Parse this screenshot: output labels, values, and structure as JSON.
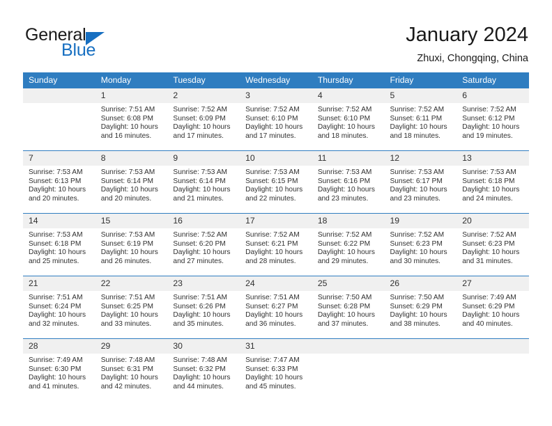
{
  "brand": {
    "name_part1": "General",
    "name_part2": "Blue",
    "triangle_color": "#176fc1"
  },
  "header": {
    "month_title": "January 2024",
    "location": "Zhuxi, Chongqing, China"
  },
  "colors": {
    "header_blue": "#2f7dc0",
    "brand_blue": "#176fc1",
    "daynum_band": "#f0f0f0",
    "text": "#303030"
  },
  "weekday_headers": [
    "Sunday",
    "Monday",
    "Tuesday",
    "Wednesday",
    "Thursday",
    "Friday",
    "Saturday"
  ],
  "weeks": [
    [
      {
        "day": "",
        "lines": []
      },
      {
        "day": "1",
        "lines": [
          "Sunrise: 7:51 AM",
          "Sunset: 6:08 PM",
          "Daylight: 10 hours",
          "and 16 minutes."
        ]
      },
      {
        "day": "2",
        "lines": [
          "Sunrise: 7:52 AM",
          "Sunset: 6:09 PM",
          "Daylight: 10 hours",
          "and 17 minutes."
        ]
      },
      {
        "day": "3",
        "lines": [
          "Sunrise: 7:52 AM",
          "Sunset: 6:10 PM",
          "Daylight: 10 hours",
          "and 17 minutes."
        ]
      },
      {
        "day": "4",
        "lines": [
          "Sunrise: 7:52 AM",
          "Sunset: 6:10 PM",
          "Daylight: 10 hours",
          "and 18 minutes."
        ]
      },
      {
        "day": "5",
        "lines": [
          "Sunrise: 7:52 AM",
          "Sunset: 6:11 PM",
          "Daylight: 10 hours",
          "and 18 minutes."
        ]
      },
      {
        "day": "6",
        "lines": [
          "Sunrise: 7:52 AM",
          "Sunset: 6:12 PM",
          "Daylight: 10 hours",
          "and 19 minutes."
        ]
      }
    ],
    [
      {
        "day": "7",
        "lines": [
          "Sunrise: 7:53 AM",
          "Sunset: 6:13 PM",
          "Daylight: 10 hours",
          "and 20 minutes."
        ]
      },
      {
        "day": "8",
        "lines": [
          "Sunrise: 7:53 AM",
          "Sunset: 6:14 PM",
          "Daylight: 10 hours",
          "and 20 minutes."
        ]
      },
      {
        "day": "9",
        "lines": [
          "Sunrise: 7:53 AM",
          "Sunset: 6:14 PM",
          "Daylight: 10 hours",
          "and 21 minutes."
        ]
      },
      {
        "day": "10",
        "lines": [
          "Sunrise: 7:53 AM",
          "Sunset: 6:15 PM",
          "Daylight: 10 hours",
          "and 22 minutes."
        ]
      },
      {
        "day": "11",
        "lines": [
          "Sunrise: 7:53 AM",
          "Sunset: 6:16 PM",
          "Daylight: 10 hours",
          "and 23 minutes."
        ]
      },
      {
        "day": "12",
        "lines": [
          "Sunrise: 7:53 AM",
          "Sunset: 6:17 PM",
          "Daylight: 10 hours",
          "and 23 minutes."
        ]
      },
      {
        "day": "13",
        "lines": [
          "Sunrise: 7:53 AM",
          "Sunset: 6:18 PM",
          "Daylight: 10 hours",
          "and 24 minutes."
        ]
      }
    ],
    [
      {
        "day": "14",
        "lines": [
          "Sunrise: 7:53 AM",
          "Sunset: 6:18 PM",
          "Daylight: 10 hours",
          "and 25 minutes."
        ]
      },
      {
        "day": "15",
        "lines": [
          "Sunrise: 7:53 AM",
          "Sunset: 6:19 PM",
          "Daylight: 10 hours",
          "and 26 minutes."
        ]
      },
      {
        "day": "16",
        "lines": [
          "Sunrise: 7:52 AM",
          "Sunset: 6:20 PM",
          "Daylight: 10 hours",
          "and 27 minutes."
        ]
      },
      {
        "day": "17",
        "lines": [
          "Sunrise: 7:52 AM",
          "Sunset: 6:21 PM",
          "Daylight: 10 hours",
          "and 28 minutes."
        ]
      },
      {
        "day": "18",
        "lines": [
          "Sunrise: 7:52 AM",
          "Sunset: 6:22 PM",
          "Daylight: 10 hours",
          "and 29 minutes."
        ]
      },
      {
        "day": "19",
        "lines": [
          "Sunrise: 7:52 AM",
          "Sunset: 6:23 PM",
          "Daylight: 10 hours",
          "and 30 minutes."
        ]
      },
      {
        "day": "20",
        "lines": [
          "Sunrise: 7:52 AM",
          "Sunset: 6:23 PM",
          "Daylight: 10 hours",
          "and 31 minutes."
        ]
      }
    ],
    [
      {
        "day": "21",
        "lines": [
          "Sunrise: 7:51 AM",
          "Sunset: 6:24 PM",
          "Daylight: 10 hours",
          "and 32 minutes."
        ]
      },
      {
        "day": "22",
        "lines": [
          "Sunrise: 7:51 AM",
          "Sunset: 6:25 PM",
          "Daylight: 10 hours",
          "and 33 minutes."
        ]
      },
      {
        "day": "23",
        "lines": [
          "Sunrise: 7:51 AM",
          "Sunset: 6:26 PM",
          "Daylight: 10 hours",
          "and 35 minutes."
        ]
      },
      {
        "day": "24",
        "lines": [
          "Sunrise: 7:51 AM",
          "Sunset: 6:27 PM",
          "Daylight: 10 hours",
          "and 36 minutes."
        ]
      },
      {
        "day": "25",
        "lines": [
          "Sunrise: 7:50 AM",
          "Sunset: 6:28 PM",
          "Daylight: 10 hours",
          "and 37 minutes."
        ]
      },
      {
        "day": "26",
        "lines": [
          "Sunrise: 7:50 AM",
          "Sunset: 6:29 PM",
          "Daylight: 10 hours",
          "and 38 minutes."
        ]
      },
      {
        "day": "27",
        "lines": [
          "Sunrise: 7:49 AM",
          "Sunset: 6:29 PM",
          "Daylight: 10 hours",
          "and 40 minutes."
        ]
      }
    ],
    [
      {
        "day": "28",
        "lines": [
          "Sunrise: 7:49 AM",
          "Sunset: 6:30 PM",
          "Daylight: 10 hours",
          "and 41 minutes."
        ]
      },
      {
        "day": "29",
        "lines": [
          "Sunrise: 7:48 AM",
          "Sunset: 6:31 PM",
          "Daylight: 10 hours",
          "and 42 minutes."
        ]
      },
      {
        "day": "30",
        "lines": [
          "Sunrise: 7:48 AM",
          "Sunset: 6:32 PM",
          "Daylight: 10 hours",
          "and 44 minutes."
        ]
      },
      {
        "day": "31",
        "lines": [
          "Sunrise: 7:47 AM",
          "Sunset: 6:33 PM",
          "Daylight: 10 hours",
          "and 45 minutes."
        ]
      },
      {
        "day": "",
        "lines": []
      },
      {
        "day": "",
        "lines": []
      },
      {
        "day": "",
        "lines": []
      }
    ]
  ]
}
